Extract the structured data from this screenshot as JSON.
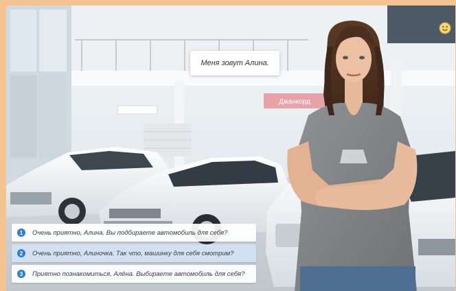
{
  "dialogue": {
    "npc_line": "Меня зовут Алина.",
    "showroom_sign": "Джанкорд",
    "choices": [
      {
        "number": "1",
        "text": "Очень приятно, Алина. Вы подбираете автомобиль для себя?"
      },
      {
        "number": "2",
        "text": "Очень приятно, Алиночка. Так что, машинку для себя смотрим?"
      },
      {
        "number": "3",
        "text": "Приятно познакомиться, Алёна. Выбираете автомобиль для себя?"
      }
    ]
  },
  "hud": {
    "mood_icon": "smiley-face-icon"
  },
  "colors": {
    "frame_background": "#f6c490",
    "choice_number": "#2f7fd3",
    "highlighted_choice": "#d2e1f3"
  }
}
